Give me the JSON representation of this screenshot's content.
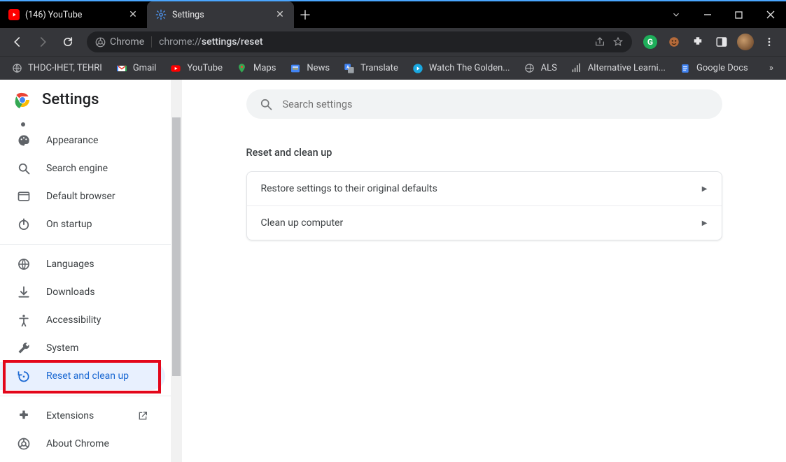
{
  "window": {
    "tabs": [
      {
        "title": "(146) YouTube",
        "active": false,
        "favicon": "youtube"
      },
      {
        "title": "Settings",
        "active": true,
        "favicon": "gear-blue"
      }
    ]
  },
  "toolbar": {
    "chip_label": "Chrome",
    "url_prefix": "chrome://",
    "url_bold": "settings/reset",
    "url_suffix": ""
  },
  "bookmarks": [
    {
      "label": "THDC-IHET, TEHRI",
      "icon": "globe"
    },
    {
      "label": "Gmail",
      "icon": "gmail"
    },
    {
      "label": "YouTube",
      "icon": "youtube"
    },
    {
      "label": "Maps",
      "icon": "maps"
    },
    {
      "label": "News",
      "icon": "news"
    },
    {
      "label": "Translate",
      "icon": "translate"
    },
    {
      "label": "Watch The Golden...",
      "icon": "play"
    },
    {
      "label": "ALS",
      "icon": "globe"
    },
    {
      "label": "Alternative Learni...",
      "icon": "signal"
    },
    {
      "label": "Google Docs",
      "icon": "docs"
    }
  ],
  "brand": {
    "title": "Settings"
  },
  "nav": {
    "items": [
      {
        "label": "Appearance",
        "icon": "palette",
        "active": false
      },
      {
        "label": "Search engine",
        "icon": "search",
        "active": false
      },
      {
        "label": "Default browser",
        "icon": "browser",
        "active": false
      },
      {
        "label": "On startup",
        "icon": "power",
        "active": false
      },
      {
        "divider": true
      },
      {
        "label": "Languages",
        "icon": "globe",
        "active": false
      },
      {
        "label": "Downloads",
        "icon": "download",
        "active": false
      },
      {
        "label": "Accessibility",
        "icon": "accessibility",
        "active": false
      },
      {
        "label": "System",
        "icon": "wrench",
        "active": false
      },
      {
        "label": "Reset and clean up",
        "icon": "restore",
        "active": true
      },
      {
        "divider": true
      },
      {
        "label": "Extensions",
        "icon": "extension",
        "active": false,
        "external": true
      },
      {
        "label": "About Chrome",
        "icon": "chrome",
        "active": false
      }
    ]
  },
  "search": {
    "placeholder": "Search settings"
  },
  "section": {
    "title": "Reset and clean up",
    "rows": [
      "Restore settings to their original defaults",
      "Clean up computer"
    ]
  }
}
